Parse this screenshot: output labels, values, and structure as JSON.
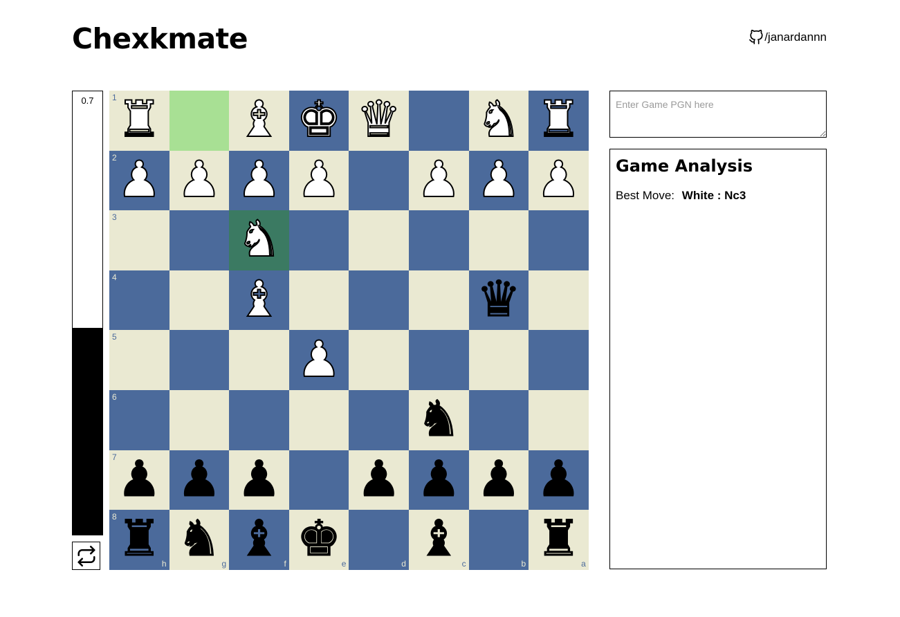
{
  "app": {
    "title": "Chexkmate",
    "github_label": "/janardannn"
  },
  "eval": {
    "value_text": "0.7",
    "white_share": 0.533
  },
  "pgn": {
    "placeholder": "Enter Game PGN here",
    "value": ""
  },
  "analysis": {
    "heading": "Game Analysis",
    "best_move_label": "Best Move:",
    "best_move_value": "White : Nc3"
  },
  "board": {
    "orientation": "black",
    "rows": [
      {
        "rank": "1",
        "cells": [
          "♜w",
          "",
          "♝w",
          "♚w",
          "♛w",
          "",
          "♞w",
          "♜w"
        ]
      },
      {
        "rank": "2",
        "cells": [
          "♟w",
          "♟w",
          "♟w",
          "♟w",
          "",
          "♟w",
          "♟w",
          "♟w"
        ]
      },
      {
        "rank": "3",
        "cells": [
          "",
          "",
          "♞w",
          "",
          "",
          "",
          "",
          ""
        ]
      },
      {
        "rank": "4",
        "cells": [
          "",
          "",
          "♝w",
          "",
          "",
          "",
          "♛b",
          ""
        ]
      },
      {
        "rank": "5",
        "cells": [
          "",
          "",
          "",
          "♟w",
          "",
          "",
          "",
          ""
        ]
      },
      {
        "rank": "6",
        "cells": [
          "",
          "",
          "",
          "",
          "",
          "♞b",
          "",
          ""
        ]
      },
      {
        "rank": "7",
        "cells": [
          "♟b",
          "♟b",
          "♟b",
          "",
          "♟b",
          "♟b",
          "♟b",
          "♟b"
        ]
      },
      {
        "rank": "8",
        "cells": [
          "♜b",
          "♞b",
          "♝b",
          "♚b",
          "",
          "♝b",
          "",
          "♜b"
        ]
      }
    ],
    "files": [
      "h",
      "g",
      "f",
      "e",
      "d",
      "c",
      "b",
      "a"
    ],
    "highlights": [
      "g1",
      "f3"
    ],
    "colors": {
      "light": "#eae9d2",
      "dark": "#4b6a9b",
      "highlight_from": "#a8e094",
      "highlight_to": "#3b7a62"
    }
  }
}
